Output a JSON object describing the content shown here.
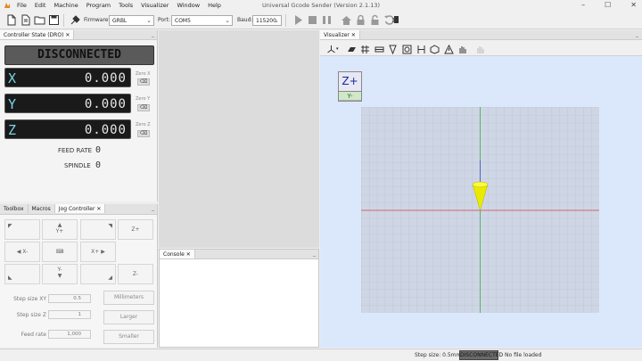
{
  "window": {
    "title": "Universal Gcode Sender (Version 2.1.13)"
  },
  "menu": [
    "File",
    "Edit",
    "Machine",
    "Program",
    "Tools",
    "Visualizer",
    "Window",
    "Help"
  ],
  "toolbar": {
    "firmware_label": "Firmware:",
    "firmware_value": "GRBL",
    "port_label": "Port:",
    "port_value": "COM5",
    "baud_label": "Baud:",
    "baud_value": "115200"
  },
  "dro": {
    "tab": "Controller State (DRO)",
    "status": "DISCONNECTED",
    "axes": [
      {
        "axis": "X",
        "value": "0.000",
        "zero_label": "Zero X"
      },
      {
        "axis": "Y",
        "value": "0.000",
        "zero_label": "Zero Y"
      },
      {
        "axis": "Z",
        "value": "0.000",
        "zero_label": "Zero Z"
      }
    ],
    "feed_label": "FEED RATE",
    "feed_value": "0",
    "spindle_label": "SPINDLE",
    "spindle_value": "0"
  },
  "jog": {
    "tabs": [
      "Toolbox",
      "Macros",
      "Jog Controller"
    ],
    "buttons": {
      "yplus": "Y+",
      "zplus": "Z+",
      "xminus": "X-",
      "xplus": "X+",
      "yminus": "Y-",
      "zminus": "Z-"
    },
    "step_xy_label": "Step size XY",
    "step_xy_value": "0.5",
    "step_z_label": "Step size Z",
    "step_z_value": "1",
    "feed_label": "Feed rate",
    "feed_value": "1,000",
    "units_button": "Millimeters",
    "larger_button": "Larger",
    "smaller_button": "Smaller"
  },
  "console": {
    "tab": "Console"
  },
  "visualizer": {
    "tab": "Visualizer",
    "zplus": "Z+",
    "yminus": "Y-"
  },
  "status": {
    "step_size": "Step size: 0.5mm",
    "state": "DISCONNECTED",
    "file": "No file loaded"
  }
}
